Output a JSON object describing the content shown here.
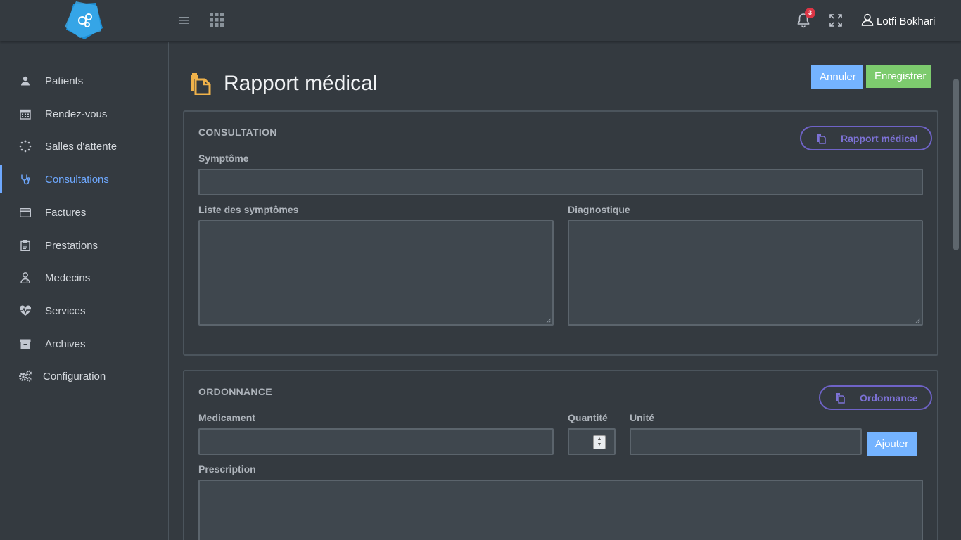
{
  "header": {
    "notifications_count": "3",
    "user_name": "Lotfi Bokhari"
  },
  "sidebar": {
    "items": [
      {
        "label": "Patients",
        "icon": "user-icon"
      },
      {
        "label": "Rendez-vous",
        "icon": "calendar-icon"
      },
      {
        "label": "Salles d'attente",
        "icon": "spinner-icon"
      },
      {
        "label": "Consultations",
        "icon": "stethoscope-icon",
        "active": true
      },
      {
        "label": "Factures",
        "icon": "credit-card-icon"
      },
      {
        "label": "Prestations",
        "icon": "clipboard-icon"
      },
      {
        "label": "Medecins",
        "icon": "doctor-icon"
      },
      {
        "label": "Services",
        "icon": "heartbeat-icon"
      },
      {
        "label": "Archives",
        "icon": "archive-icon"
      },
      {
        "label": "Configuration",
        "icon": "cogs-icon"
      }
    ]
  },
  "page": {
    "title": "Rapport médical",
    "cancel_label": "Annuler",
    "save_label": "Enregistrer"
  },
  "consultation": {
    "section_title": "CONSULTATION",
    "report_button": "Rapport médical",
    "symptom_label": "Symptôme",
    "symptom_value": "",
    "symptom_list_label": "Liste des symptômes",
    "diagnostic_label": "Diagnostique"
  },
  "ordonnance": {
    "section_title": "ORDONNANCE",
    "ordonnance_button": "Ordonnance",
    "medicament_label": "Medicament",
    "quantite_label": "Quantité",
    "unite_label": "Unité",
    "add_label": "Ajouter",
    "prescription_label": "Prescription"
  },
  "colors": {
    "accent": "#6ea8fe",
    "success": "#7dcb6e",
    "pill": "#6f63c7",
    "page_icon": "#f0b24a"
  }
}
